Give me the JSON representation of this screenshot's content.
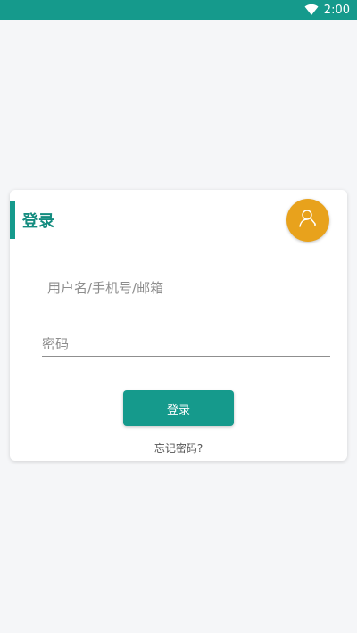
{
  "status_bar": {
    "time": "2:00",
    "wifi_icon": "wifi-icon",
    "color": "#159a8c"
  },
  "login_card": {
    "title": "登录",
    "avatar_icon": "user-search-icon",
    "avatar_color": "#e8a21c",
    "username_placeholder": "用户名/手机号/邮箱",
    "username_value": "",
    "password_placeholder": "密码",
    "password_value": "",
    "login_button_label": "登录",
    "forgot_password_link": "忘记密码?"
  }
}
